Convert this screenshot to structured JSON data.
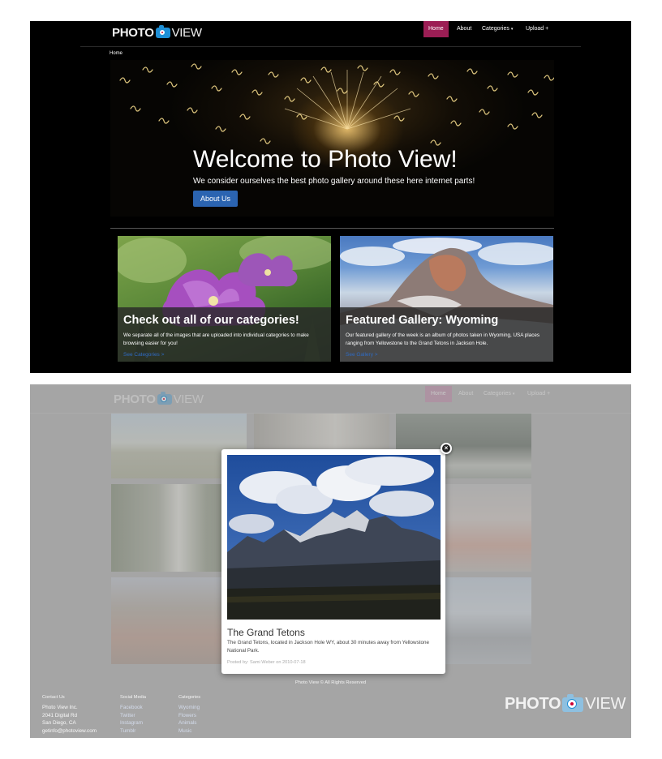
{
  "top": {
    "logo": {
      "part1": "PHOTO",
      "part2": "VIEW"
    },
    "nav": [
      "Home",
      "About",
      "Categories",
      "Upload +"
    ],
    "breadcrumb": "Home",
    "hero": {
      "title": "Welcome to Photo View!",
      "subtitle": "We consider ourselves the best photo gallery around these here internet parts!",
      "button": "About Us"
    },
    "cards": [
      {
        "title": "Check out all of our categories!",
        "text": "We separate all of the images that are uploaded into individual categories to make browsing easier for you!",
        "link": "See Categories >"
      },
      {
        "title": "Featured Gallery: Wyoming",
        "text": "Our featured gallery of the week is an album of photos taken in Wyoming, USA places ranging from Yellowstone to the Grand Tetons in Jackson Hole.",
        "link": "See Gallery >"
      }
    ]
  },
  "bottom": {
    "logo": {
      "part1": "PHOTO",
      "part2": "VIEW"
    },
    "nav": [
      "Home",
      "About",
      "Categories",
      "Upload +"
    ],
    "modal": {
      "title": "The Grand Tetons",
      "description": "The Grand Tetons, located in Jackson Hole WY, about 30 minutes away from Yellowstone National Park.",
      "meta": "Posted by: Sami Weber on 2010-07-18",
      "close": "×"
    },
    "footer": {
      "copyright": "Photo View © All Rights Reserved",
      "contact": {
        "heading": "Contact Us",
        "lines": [
          "Photo View Inc.",
          "2041 Digital Rd",
          "San Diego, CA",
          "getinfo@photoview.com"
        ]
      },
      "social": {
        "heading": "Social Media",
        "links": [
          "Facebook",
          "Twitter",
          "Instagram",
          "Tumblr"
        ]
      },
      "categories": {
        "heading": "Categories",
        "links": [
          "Wyoming",
          "Flowers",
          "Animals",
          "Music"
        ]
      },
      "logo": {
        "part1": "PHOTO",
        "part2": "VIEW"
      }
    }
  },
  "colors": {
    "accent": "#9c1e55",
    "button": "#2b64b1",
    "link": "#2f6bc4",
    "camera": "#1e8fd6"
  }
}
